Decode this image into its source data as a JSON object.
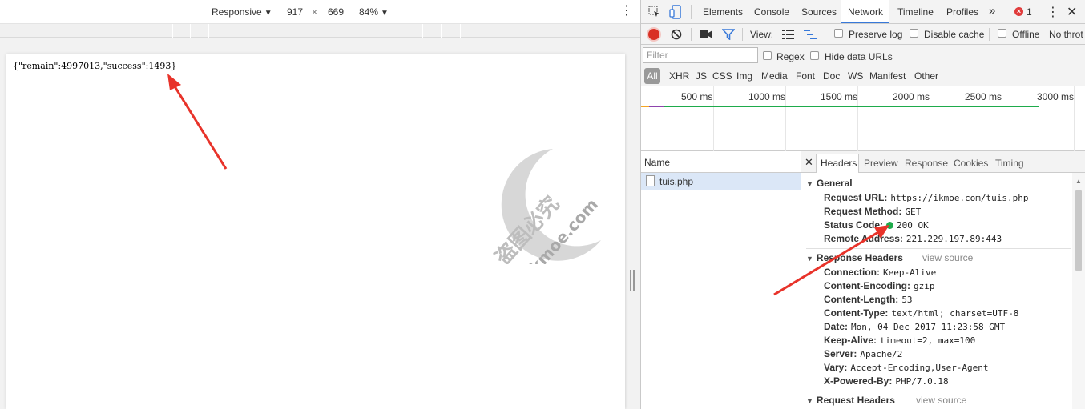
{
  "emulation": {
    "device": "Responsive",
    "width": "917",
    "times": "×",
    "height": "669",
    "zoom": "84%"
  },
  "page": {
    "json_text": "{\"remain\":4997013,\"success\":1493}"
  },
  "watermark": {
    "text_cn": "盗图必究",
    "text_en": "ikmoe.com"
  },
  "devtools": {
    "tabs": [
      "Elements",
      "Console",
      "Sources",
      "Network",
      "Timeline",
      "Profiles"
    ],
    "active_tab": "Network",
    "more": "»",
    "error_count": "1",
    "toolbar": {
      "view_label": "View:",
      "preserve_log": "Preserve log",
      "disable_cache": "Disable cache",
      "offline": "Offline",
      "throttle": "No throt"
    },
    "filter": {
      "placeholder": "Filter",
      "regex": "Regex",
      "hide_data_urls": "Hide data URLs"
    },
    "types": [
      "All",
      "XHR",
      "JS",
      "CSS",
      "Img",
      "Media",
      "Font",
      "Doc",
      "WS",
      "Manifest",
      "Other"
    ],
    "timeline_labels": [
      "500 ms",
      "1000 ms",
      "1500 ms",
      "2000 ms",
      "2500 ms",
      "3000 ms"
    ],
    "name_header": "Name",
    "request_name": "tuis.php",
    "detail_tabs": [
      "Headers",
      "Preview",
      "Response",
      "Cookies",
      "Timing"
    ],
    "general": {
      "title": "General",
      "rows": [
        {
          "k": "Request URL:",
          "v": "https://ikmoe.com/tuis.php"
        },
        {
          "k": "Request Method:",
          "v": "GET"
        },
        {
          "k": "Status Code:",
          "v": "200 OK"
        },
        {
          "k": "Remote Address:",
          "v": "221.229.197.89:443"
        }
      ]
    },
    "response_headers": {
      "title": "Response Headers",
      "view_source": "view source",
      "rows": [
        {
          "k": "Connection:",
          "v": "Keep-Alive"
        },
        {
          "k": "Content-Encoding:",
          "v": "gzip"
        },
        {
          "k": "Content-Length:",
          "v": "53"
        },
        {
          "k": "Content-Type:",
          "v": "text/html; charset=UTF-8"
        },
        {
          "k": "Date:",
          "v": "Mon, 04 Dec 2017 11:23:58 GMT"
        },
        {
          "k": "Keep-Alive:",
          "v": "timeout=2, max=100"
        },
        {
          "k": "Server:",
          "v": "Apache/2"
        },
        {
          "k": "Vary:",
          "v": "Accept-Encoding,User-Agent"
        },
        {
          "k": "X-Powered-By:",
          "v": "PHP/7.0.18"
        }
      ]
    },
    "request_headers": {
      "title": "Request Headers",
      "view_source": "view source"
    }
  },
  "colors": {
    "accent": "#3879d9",
    "success": "#1eab4b",
    "record": "#d93025",
    "arrow": "#e8332a"
  }
}
